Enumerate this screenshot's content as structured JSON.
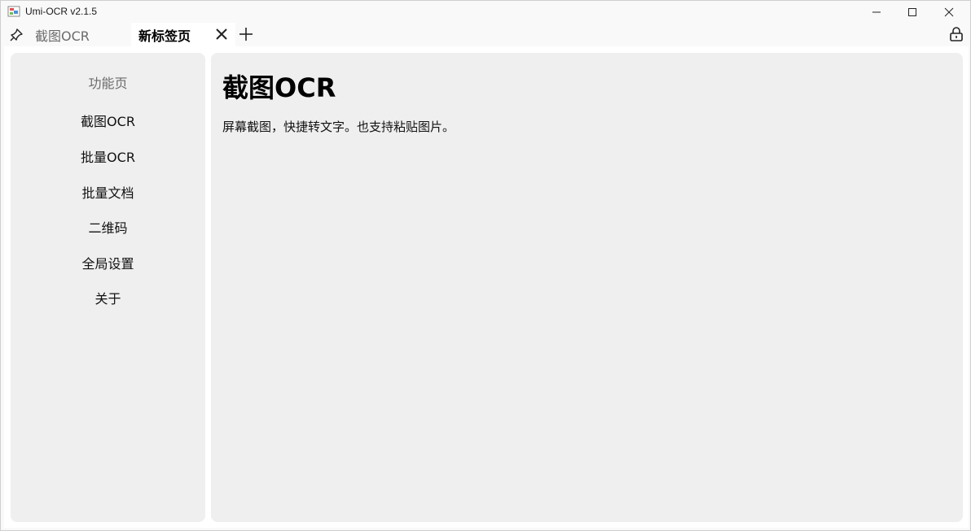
{
  "window": {
    "title": "Umi-OCR v2.1.5",
    "controls": {
      "minimize": "minimize-icon",
      "maximize": "maximize-icon",
      "close": "close-icon"
    }
  },
  "tabs": {
    "pinned_icon": "pin-icon",
    "items": [
      {
        "label": "截图OCR",
        "active": false
      },
      {
        "label": "新标签页",
        "active": true
      }
    ],
    "add_icon": "plus-icon",
    "lock_icon": "lock-icon"
  },
  "sidebar": {
    "header": "功能页",
    "items": [
      {
        "label": "截图OCR"
      },
      {
        "label": "批量OCR"
      },
      {
        "label": "批量文档"
      },
      {
        "label": "二维码"
      },
      {
        "label": "全局设置"
      },
      {
        "label": "关于"
      }
    ]
  },
  "main": {
    "title": "截图OCR",
    "description": "屏幕截图，快捷转文字。也支持粘贴图片。"
  },
  "colors": {
    "panel_bg": "#efefef",
    "window_bg": "#f9f9f9",
    "muted_text": "#6b6b6b"
  }
}
